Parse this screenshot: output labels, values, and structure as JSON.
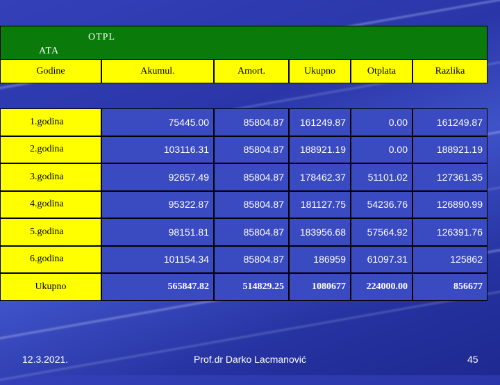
{
  "title": {
    "line1": "OTPL",
    "line2": "ATA"
  },
  "headers": [
    "Godine",
    "Akumul.",
    "Amort.",
    "Ukupno",
    "Otplata",
    "Razlika"
  ],
  "rows": [
    {
      "label": "1.godina",
      "values": [
        "75445.00",
        "85804.87",
        "161249.87",
        "0.00",
        "161249.87"
      ]
    },
    {
      "label": "2.godina",
      "values": [
        "103116.31",
        "85804.87",
        "188921.19",
        "0.00",
        "188921.19"
      ]
    },
    {
      "label": "3.godina",
      "values": [
        "92657.49",
        "85804.87",
        "178462.37",
        "51101.02",
        "127361.35"
      ]
    },
    {
      "label": "4.godina",
      "values": [
        "95322.87",
        "85804.87",
        "181127.75",
        "54236.76",
        "126890.99"
      ]
    },
    {
      "label": "5.godina",
      "values": [
        "98151.81",
        "85804.87",
        "183956.68",
        "57564.92",
        "126391.76"
      ]
    },
    {
      "label": "6.godina",
      "values": [
        "101154.34",
        "85804.87",
        "186959",
        "61097.31",
        "125862"
      ]
    }
  ],
  "total": {
    "label": "Ukupno",
    "values": [
      "565847.82",
      "514829.25",
      "1080677",
      "224000.00",
      "856677"
    ]
  },
  "footer": {
    "date": "12.3.2021.",
    "author": "Prof.dr Darko Lacmanović",
    "page": "45"
  },
  "colors": {
    "title_bg": "#0a7a0a",
    "label_bg": "#ffff00",
    "cell_bg": "#3a4ac0"
  }
}
